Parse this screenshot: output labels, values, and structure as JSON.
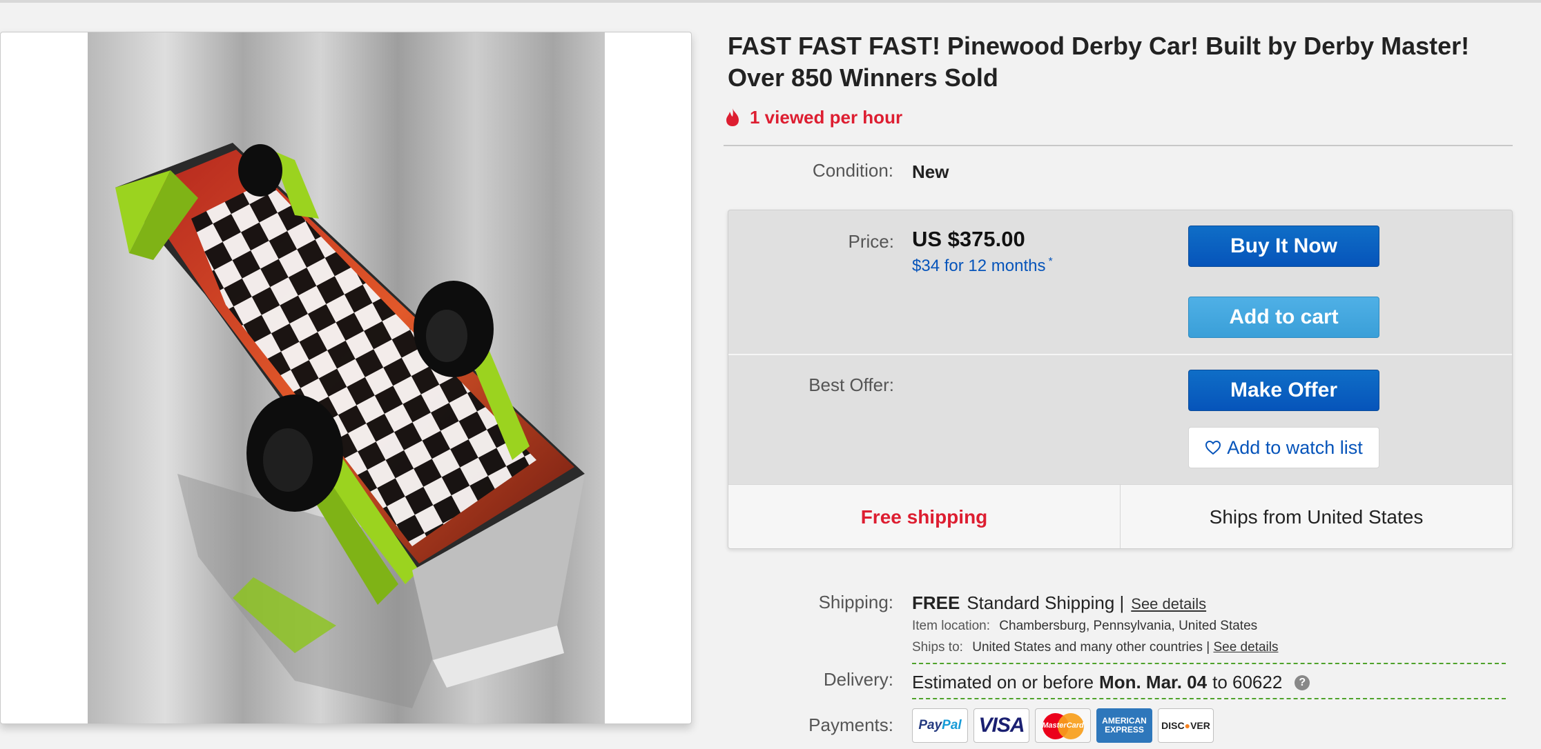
{
  "listing": {
    "title": "FAST FAST FAST! Pinewood Derby Car! Built by Derby Master! Over 850 Winners Sold",
    "viewed": "1 viewed per hour",
    "condition_label": "Condition:",
    "condition_value": "New"
  },
  "buybox": {
    "price_label": "Price:",
    "price": "US $375.00",
    "financing": "$34 for 12 months",
    "financing_mark": "*",
    "buy_now": "Buy It Now",
    "add_to_cart": "Add to cart",
    "best_offer_label": "Best Offer:",
    "make_offer": "Make Offer",
    "watch_list": "Add to watch list",
    "free_shipping": "Free shipping",
    "ships_from": "Ships from United States"
  },
  "shipping": {
    "label": "Shipping:",
    "free": "FREE",
    "method": "Standard Shipping |",
    "see_details": "See details",
    "location_key": "Item location:",
    "location_value": "Chambersburg, Pennsylvania, United States",
    "ships_to_key": "Ships to:",
    "ships_to_value": "United States and many other countries |",
    "ships_to_details": "See details"
  },
  "delivery": {
    "label": "Delivery:",
    "prefix": "Estimated on or before",
    "date": "Mon. Mar. 04",
    "to": "to 60622",
    "help": "?"
  },
  "payments": {
    "label": "Payments:",
    "paypal_a": "Pay",
    "paypal_b": "Pal",
    "visa": "VISA",
    "mastercard": "MasterCard",
    "amex_1": "AMERICAN",
    "amex_2": "EXPRESS",
    "discover_a": "DISC",
    "discover_b": "●",
    "discover_c": "VER"
  },
  "colors": {
    "accent_red": "#dd1e31",
    "link_blue": "#0654ba",
    "button_blue": "#0654ba",
    "cart_blue": "#3a9fd8",
    "car_green": "#9bd31f"
  },
  "icons": {
    "viewed": "flame-icon",
    "watch": "heart-icon",
    "delivery_help": "help-icon"
  }
}
